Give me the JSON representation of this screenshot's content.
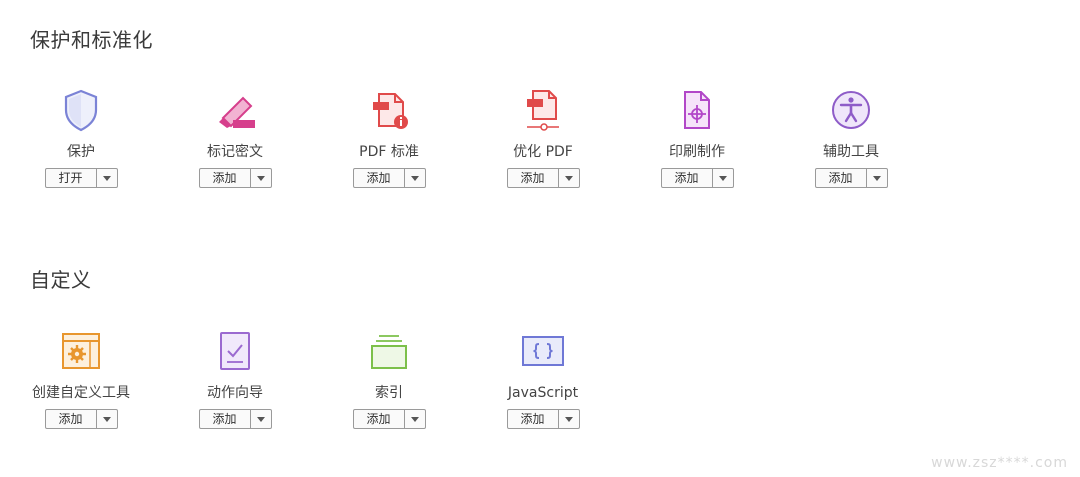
{
  "sections": [
    {
      "title": "保护和标准化",
      "tools": [
        {
          "label": "保护",
          "button": "打开",
          "icon": "shield-icon"
        },
        {
          "label": "标记密文",
          "button": "添加",
          "icon": "redact-marker-icon"
        },
        {
          "label": "PDF 标准",
          "button": "添加",
          "icon": "pdf-standards-icon"
        },
        {
          "label": "优化 PDF",
          "button": "添加",
          "icon": "optimize-pdf-icon"
        },
        {
          "label": "印刷制作",
          "button": "添加",
          "icon": "print-production-icon"
        },
        {
          "label": "辅助工具",
          "button": "添加",
          "icon": "accessibility-icon"
        }
      ]
    },
    {
      "title": "自定义",
      "tools": [
        {
          "label": "创建自定义工具",
          "button": "添加",
          "icon": "custom-tool-gear-icon"
        },
        {
          "label": "动作向导",
          "button": "添加",
          "icon": "action-wizard-icon"
        },
        {
          "label": "索引",
          "button": "添加",
          "icon": "index-stack-icon"
        },
        {
          "label": "JavaScript",
          "button": "添加",
          "icon": "javascript-braces-icon"
        }
      ]
    }
  ],
  "watermark": "www.zsz****.com",
  "colors": {
    "shield": "#7b83d6",
    "redact": "#d63f8c",
    "pdf_red": "#e04a4a",
    "print_purple": "#b247c8",
    "accessibility_purple": "#8e5cc8",
    "custom_orange": "#e8962e",
    "action_purple": "#9b6ad0",
    "index_green": "#7cc04a",
    "js_blue": "#6f78d6"
  }
}
